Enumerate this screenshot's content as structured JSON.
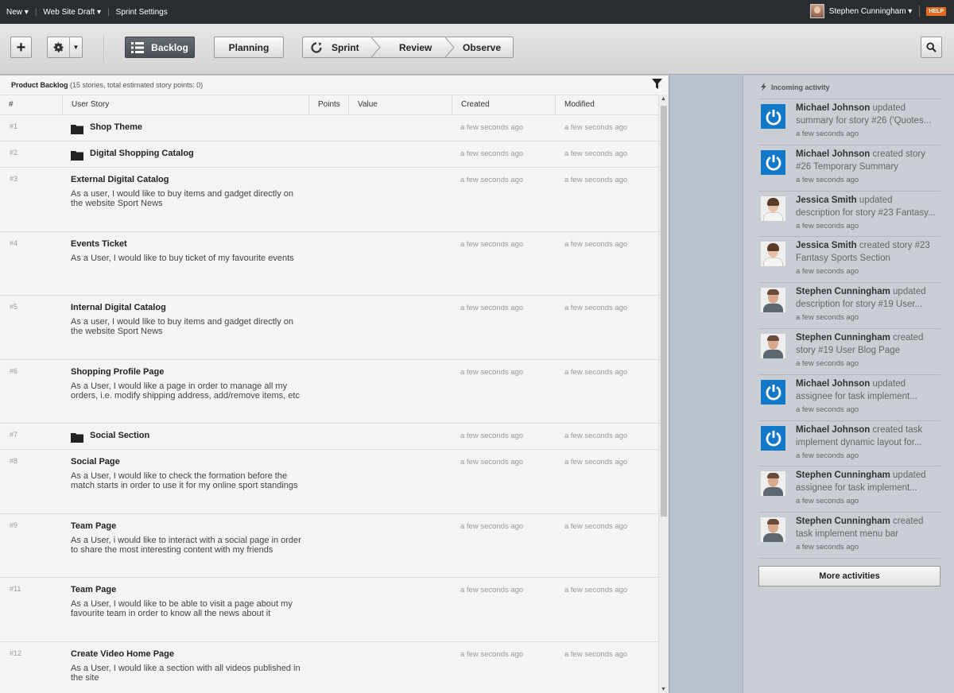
{
  "topbar": {
    "menu": [
      {
        "label": "New ▾"
      },
      {
        "label": "Web Site Draft ▾"
      },
      {
        "label": "Sprint Settings"
      }
    ],
    "user_name": "Stephen Cunningham ▾",
    "help_label": "HELP"
  },
  "toolbar": {
    "add_label": "+",
    "backlog_label": "Backlog",
    "planning_label": "Planning",
    "sprint_label": "Sprint",
    "review_label": "Review",
    "observe_label": "Observe"
  },
  "backlog": {
    "title": "Product Backlog",
    "subtitle": "(15 stories, total estimated story points: 0)",
    "columns": [
      "#",
      "User Story",
      "Points",
      "Value",
      "Created",
      "Modified"
    ],
    "rows": [
      {
        "num": "#1",
        "title": "Shop Theme",
        "folder": true,
        "desc": "",
        "created": "a few seconds ago",
        "modified": "a few seconds ago"
      },
      {
        "num": "#2",
        "title": "Digital Shopping Catalog",
        "folder": true,
        "desc": "",
        "created": "a few seconds ago",
        "modified": "a few seconds ago"
      },
      {
        "num": "#3",
        "title": "External Digital Catalog",
        "folder": false,
        "desc": "As a user, I would like to buy items and gadget directly on the website Sport News",
        "created": "a few seconds ago",
        "modified": "a few seconds ago"
      },
      {
        "num": "#4",
        "title": "Events Ticket",
        "folder": false,
        "desc": "As a User, I would like to buy ticket of my favourite events",
        "created": "a few seconds ago",
        "modified": "a few seconds ago"
      },
      {
        "num": "#5",
        "title": "Internal Digital Catalog",
        "folder": false,
        "desc": "As a user, I would like to buy items and gadget directly on the website Sport News",
        "created": "a few seconds ago",
        "modified": "a few seconds ago"
      },
      {
        "num": "#6",
        "title": "Shopping Profile Page",
        "folder": false,
        "desc": "As a User, I would like a page in order to manage all my orders, i.e. modify shipping address, add/remove items, etc",
        "created": "a few seconds ago",
        "modified": "a few seconds ago"
      },
      {
        "num": "#7",
        "title": "Social Section",
        "folder": true,
        "desc": "",
        "created": "a few seconds ago",
        "modified": "a few seconds ago"
      },
      {
        "num": "#8",
        "title": "Social Page",
        "folder": false,
        "desc": "As a User, I would like to check the formation before the match starts in order to use it for my online sport standings",
        "created": "a few seconds ago",
        "modified": "a few seconds ago"
      },
      {
        "num": "#9",
        "title": "Team Page",
        "folder": false,
        "desc": "As a User, i would like to interact with a social page in order to share the most interesting content with my friends",
        "created": "a few seconds ago",
        "modified": "a few seconds ago"
      },
      {
        "num": "#11",
        "title": "Team Page",
        "folder": false,
        "desc": "As a User, I would like to be able to visit a page about my favourite team in order to know all the news about it",
        "created": "a few seconds ago",
        "modified": "a few seconds ago"
      },
      {
        "num": "#12",
        "title": "Create Video Home Page",
        "folder": false,
        "desc": "As a User, I would like a section with all videos published in the site",
        "created": "a few seconds ago",
        "modified": "a few seconds ago"
      }
    ]
  },
  "activity": {
    "title": "Incoming activity",
    "items": [
      {
        "avatar": "mj",
        "user": "Michael Johnson",
        "action": " updated summary for story #26 ('Quotes...",
        "time": "a few seconds ago"
      },
      {
        "avatar": "mj",
        "user": "Michael Johnson",
        "action": " created story #26 Temporary Summary",
        "time": "a few seconds ago"
      },
      {
        "avatar": "js",
        "user": "Jessica Smith",
        "action": " updated description for story #23 Fantasy...",
        "time": "a few seconds ago"
      },
      {
        "avatar": "js",
        "user": "Jessica Smith",
        "action": " created story #23 Fantasy Sports Section",
        "time": "a few seconds ago"
      },
      {
        "avatar": "sc",
        "user": "Stephen Cunningham",
        "action": " updated description for story #19 User...",
        "time": "a few seconds ago"
      },
      {
        "avatar": "sc",
        "user": "Stephen Cunningham",
        "action": " created story #19 User Blog Page",
        "time": "a few seconds ago"
      },
      {
        "avatar": "mj",
        "user": "Michael Johnson",
        "action": " updated assignee for task implement...",
        "time": "a few seconds ago"
      },
      {
        "avatar": "mj",
        "user": "Michael Johnson",
        "action": " created task implement dynamic layout for...",
        "time": "a few seconds ago"
      },
      {
        "avatar": "sc",
        "user": "Stephen Cunningham",
        "action": " updated assignee for task implement...",
        "time": "a few seconds ago"
      },
      {
        "avatar": "sc",
        "user": "Stephen Cunningham",
        "action": " created task implement menu bar",
        "time": "a few seconds ago"
      }
    ],
    "more_label": "More activities"
  },
  "colors": {
    "topbar": "#2a2d32",
    "help": "#e8691d",
    "avatar_blue": "#1478c8",
    "active_tab": "#4a4f55"
  }
}
